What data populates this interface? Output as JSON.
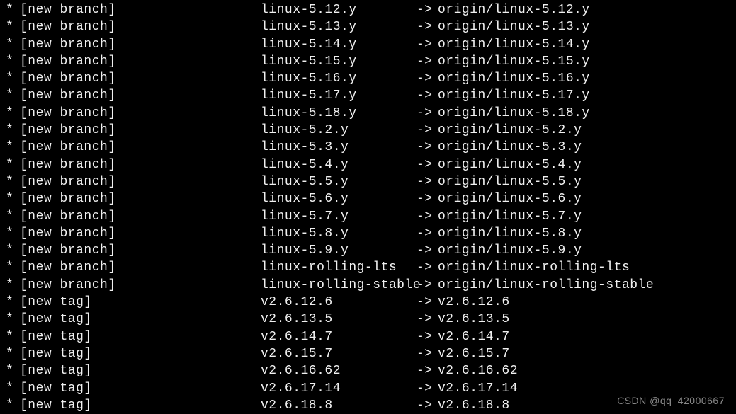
{
  "lines": [
    {
      "status": "[new branch]",
      "source": "linux-5.12.y",
      "target": "origin/linux-5.12.y"
    },
    {
      "status": "[new branch]",
      "source": "linux-5.13.y",
      "target": "origin/linux-5.13.y"
    },
    {
      "status": "[new branch]",
      "source": "linux-5.14.y",
      "target": "origin/linux-5.14.y"
    },
    {
      "status": "[new branch]",
      "source": "linux-5.15.y",
      "target": "origin/linux-5.15.y"
    },
    {
      "status": "[new branch]",
      "source": "linux-5.16.y",
      "target": "origin/linux-5.16.y"
    },
    {
      "status": "[new branch]",
      "source": "linux-5.17.y",
      "target": "origin/linux-5.17.y"
    },
    {
      "status": "[new branch]",
      "source": "linux-5.18.y",
      "target": "origin/linux-5.18.y"
    },
    {
      "status": "[new branch]",
      "source": "linux-5.2.y",
      "target": "origin/linux-5.2.y"
    },
    {
      "status": "[new branch]",
      "source": "linux-5.3.y",
      "target": "origin/linux-5.3.y"
    },
    {
      "status": "[new branch]",
      "source": "linux-5.4.y",
      "target": "origin/linux-5.4.y"
    },
    {
      "status": "[new branch]",
      "source": "linux-5.5.y",
      "target": "origin/linux-5.5.y"
    },
    {
      "status": "[new branch]",
      "source": "linux-5.6.y",
      "target": "origin/linux-5.6.y"
    },
    {
      "status": "[new branch]",
      "source": "linux-5.7.y",
      "target": "origin/linux-5.7.y"
    },
    {
      "status": "[new branch]",
      "source": "linux-5.8.y",
      "target": "origin/linux-5.8.y"
    },
    {
      "status": "[new branch]",
      "source": "linux-5.9.y",
      "target": "origin/linux-5.9.y"
    },
    {
      "status": "[new branch]",
      "source": "linux-rolling-lts",
      "target": "origin/linux-rolling-lts"
    },
    {
      "status": "[new branch]",
      "source": "linux-rolling-stable",
      "target": "origin/linux-rolling-stable"
    },
    {
      "status": "[new tag]",
      "source": "v2.6.12.6",
      "target": "v2.6.12.6"
    },
    {
      "status": "[new tag]",
      "source": "v2.6.13.5",
      "target": "v2.6.13.5"
    },
    {
      "status": "[new tag]",
      "source": "v2.6.14.7",
      "target": "v2.6.14.7"
    },
    {
      "status": "[new tag]",
      "source": "v2.6.15.7",
      "target": "v2.6.15.7"
    },
    {
      "status": "[new tag]",
      "source": "v2.6.16.62",
      "target": "v2.6.16.62"
    },
    {
      "status": "[new tag]",
      "source": "v2.6.17.14",
      "target": "v2.6.17.14"
    },
    {
      "status": "[new tag]",
      "source": "v2.6.18.8",
      "target": "v2.6.18.8"
    }
  ],
  "asterisk": "*",
  "arrow": "->",
  "watermark": "CSDN @qq_42000667"
}
